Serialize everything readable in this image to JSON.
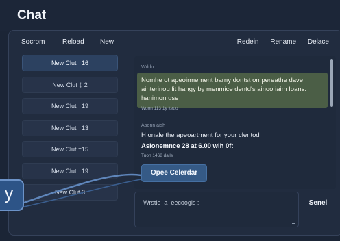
{
  "app": {
    "title": "Chat"
  },
  "sidebar": {
    "toolbar": {
      "search_label": "Socrom",
      "reload_label": "Reload",
      "new_label": "New"
    },
    "items": [
      {
        "label": "New Clut †16",
        "active": true
      },
      {
        "label": "New Clut ‡ 2",
        "active": false
      },
      {
        "label": "New Clut †19",
        "active": false
      },
      {
        "label": "New Clut †13",
        "active": false
      },
      {
        "label": "New Clut †15",
        "active": false
      },
      {
        "label": "New Clut †19",
        "active": false
      },
      {
        "label": "New Clut 3",
        "active": false
      }
    ]
  },
  "main": {
    "toolbar": {
      "redo_label": "Redein",
      "rename_label": "Rename",
      "delete_label": "Delace"
    }
  },
  "messages": {
    "first": {
      "label": "Wddo",
      "text": "Nomhe ot apeoirmement barny dontst on pereathe dave ainterinou lit hangy by menmice dentd's ainoo iaim Ioans. hanimon use",
      "meta": "Wuon 113 1y iteuo"
    },
    "second": {
      "label": "Aaonn aish",
      "line1": "H onale the apeoartment for your clentod",
      "line2": "Asionemnce 28 at 6.00 wih 0f:",
      "meta": "Tuon 1468 dalls"
    }
  },
  "actions": {
    "calendar_label": "Opee Celerdar",
    "send_label": "Senel"
  },
  "composer": {
    "placeholder": "Wrstio  a  eecoogis :"
  },
  "callout": {
    "text": "y"
  }
}
